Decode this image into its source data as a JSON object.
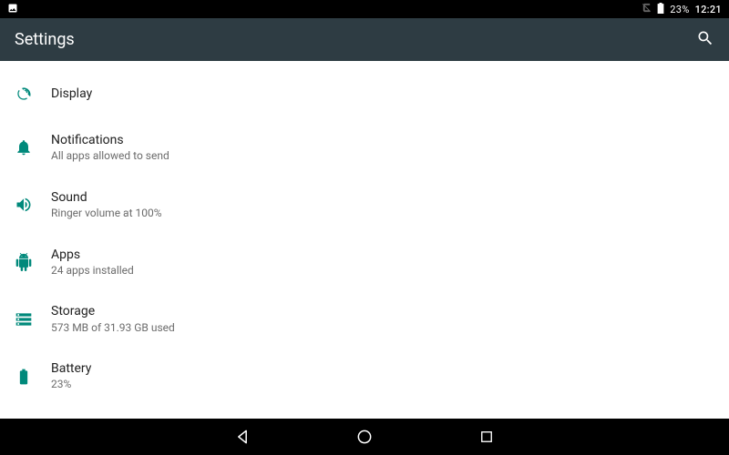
{
  "status_bar": {
    "battery_text": "23%",
    "clock": "12:21"
  },
  "app_bar": {
    "title": "Settings"
  },
  "settings": {
    "items": [
      {
        "title": "Display",
        "subtitle": ""
      },
      {
        "title": "Notifications",
        "subtitle": "All apps allowed to send"
      },
      {
        "title": "Sound",
        "subtitle": "Ringer volume at 100%"
      },
      {
        "title": "Apps",
        "subtitle": "24 apps installed"
      },
      {
        "title": "Storage",
        "subtitle": "573 MB of 31.93 GB used"
      },
      {
        "title": "Battery",
        "subtitle": "23%"
      }
    ]
  }
}
